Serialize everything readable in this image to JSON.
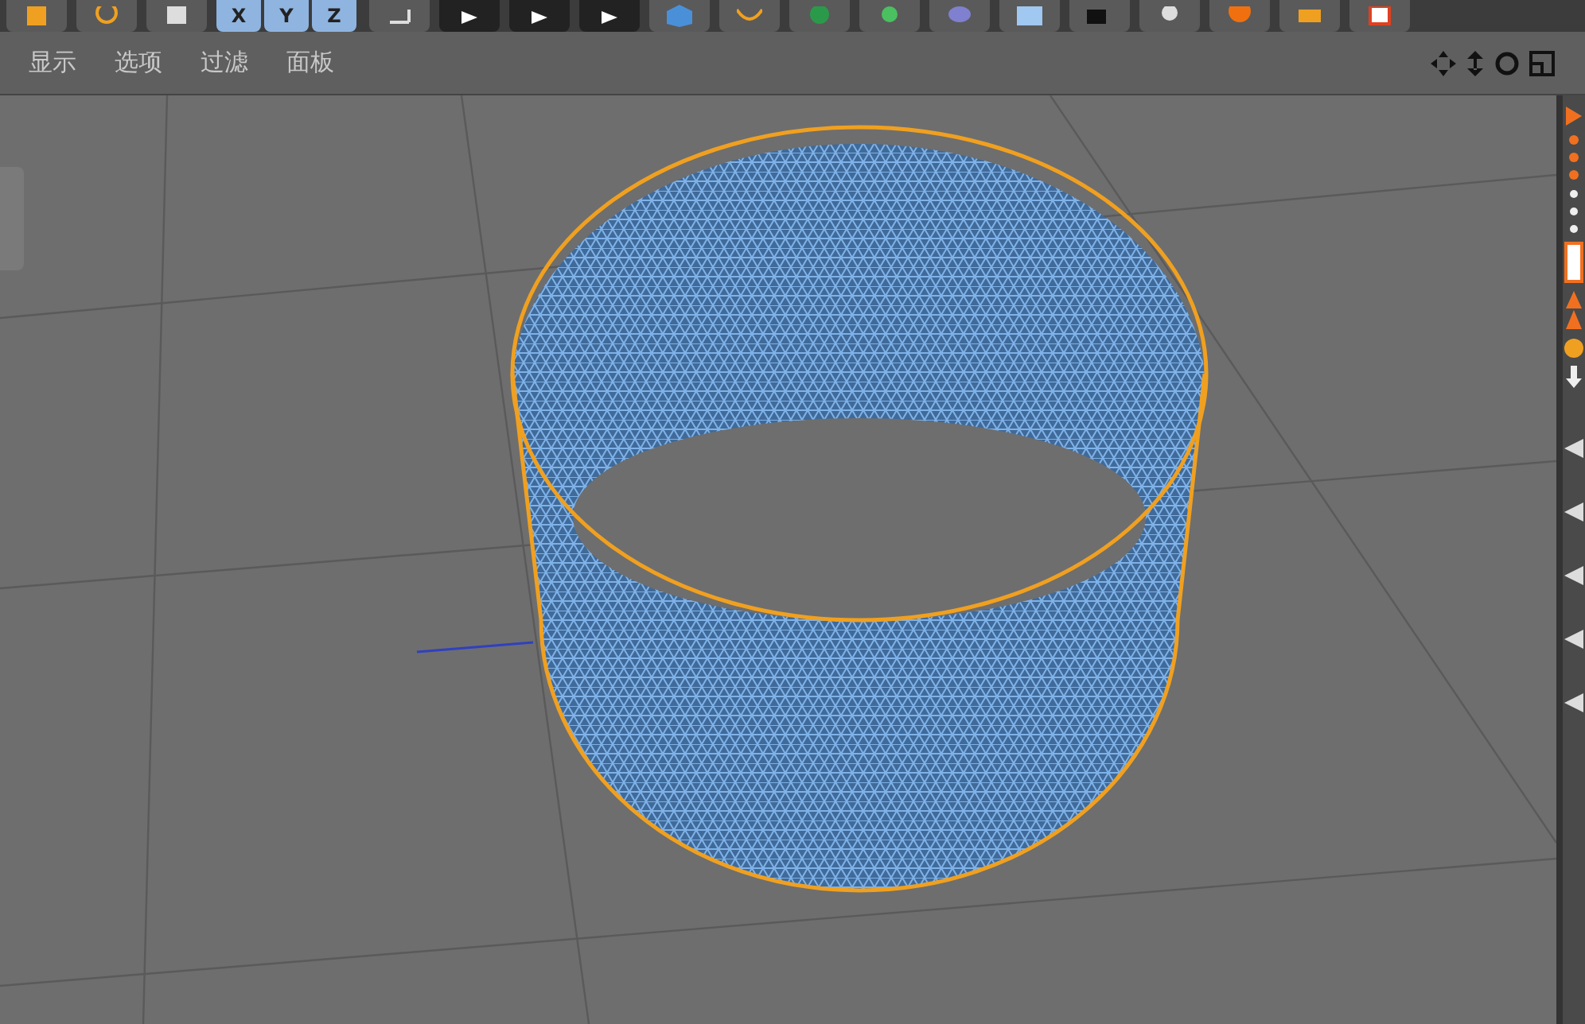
{
  "toolbar": {
    "axis_buttons": [
      {
        "label": "X",
        "selected": true
      },
      {
        "label": "Y",
        "selected": true
      },
      {
        "label": "Z",
        "selected": true
      }
    ]
  },
  "viewport_menu": [
    "显示",
    "选项",
    "过滤",
    "面板"
  ]
}
